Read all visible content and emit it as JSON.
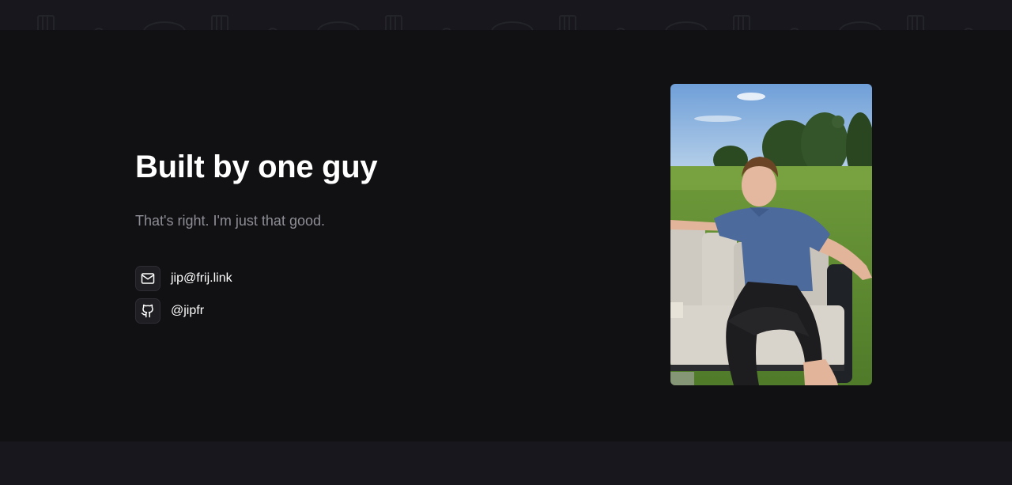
{
  "hero": {
    "title": "Built by one guy",
    "subtitle": "That's right. I'm just that good."
  },
  "contacts": [
    {
      "icon": "mail-icon",
      "label": "jip@frij.link"
    },
    {
      "icon": "github-icon",
      "label": "@jipfr"
    }
  ],
  "photo": {
    "subject": "person-on-outdoor-couch"
  },
  "colors": {
    "page_background": "#111113",
    "strip_background": "#17171d",
    "heading": "#ffffff",
    "subtitle": "#8e8e96",
    "icon_box": "#1e1e23"
  }
}
